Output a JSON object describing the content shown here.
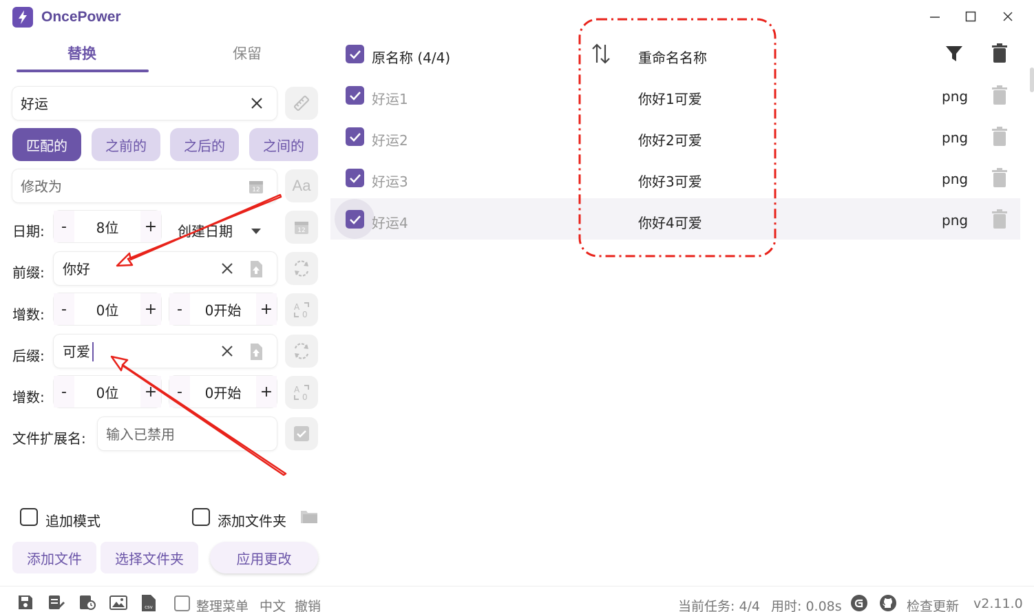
{
  "app": {
    "title": "OncePower",
    "accent": "#6b55a8"
  },
  "tabs": [
    {
      "label": "替换",
      "active": true
    },
    {
      "label": "保留",
      "active": false
    }
  ],
  "search": {
    "value": "好运"
  },
  "match_modes": [
    {
      "label": "匹配的",
      "active": true
    },
    {
      "label": "之前的",
      "active": false
    },
    {
      "label": "之后的",
      "active": false
    },
    {
      "label": "之间的",
      "active": false
    }
  ],
  "replace": {
    "placeholder": "修改为"
  },
  "date": {
    "label": "日期:",
    "digits": "8位",
    "type": "创建日期"
  },
  "prefix": {
    "label": "前缀:",
    "value": "你好"
  },
  "prefix_increment": {
    "label": "增数:",
    "digits": "0位",
    "start": "0开始"
  },
  "suffix": {
    "label": "后缀:",
    "value": "可爱"
  },
  "suffix_increment": {
    "label": "增数:",
    "digits": "0位",
    "start": "0开始"
  },
  "extension": {
    "label": "文件扩展名:",
    "placeholder": "输入已禁用"
  },
  "options": {
    "append_mode": "追加模式",
    "add_folder": "添加文件夹"
  },
  "actions": {
    "add_file": "添加文件",
    "select_folder": "选择文件夹",
    "apply": "应用更改"
  },
  "table": {
    "header_original": "原名称 (4/4)",
    "header_renamed": "重命名名称",
    "rows": [
      {
        "original": "好运1",
        "renamed": "你好1可爱",
        "ext": "png"
      },
      {
        "original": "好运2",
        "renamed": "你好2可爱",
        "ext": "png"
      },
      {
        "original": "好运3",
        "renamed": "你好3可爱",
        "ext": "png"
      },
      {
        "original": "好运4",
        "renamed": "你好4可爱",
        "ext": "png"
      }
    ]
  },
  "footer": {
    "organize_menu": "整理菜单",
    "language": "中文",
    "undo": "撤销",
    "status": "当前任务: 4/4",
    "time": "用时: 0.08s",
    "check_update": "检查更新",
    "version": "v2.11.0"
  }
}
